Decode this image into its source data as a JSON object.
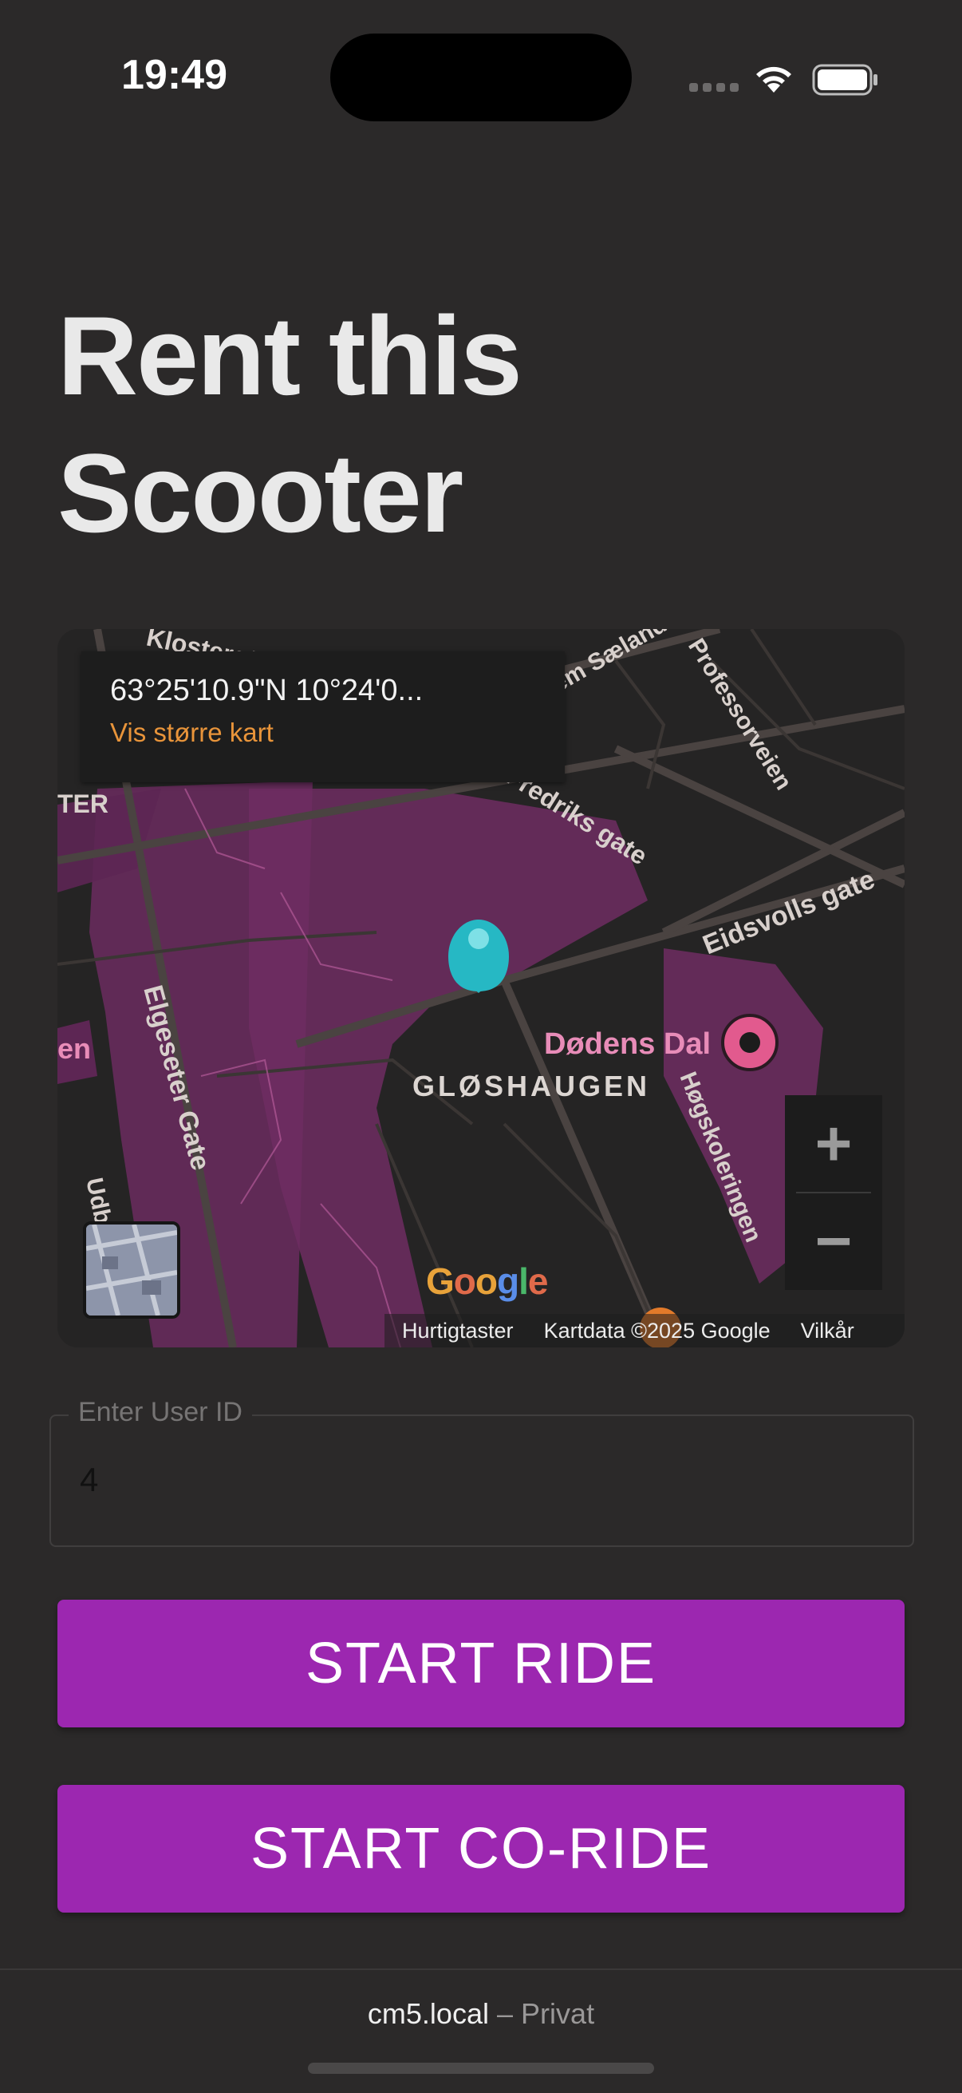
{
  "status_bar": {
    "time": "19:49"
  },
  "page": {
    "title_line1": "Rent this",
    "title_line2": "Scooter"
  },
  "map": {
    "coordinates": "63°25'10.9\"N 10°24'0...",
    "view_larger_link": "Vis større kart",
    "labels": {
      "klostergata": "Klostergt.",
      "fr_gate": "Fredriks gate",
      "s_gate": "Sem Sælands gate",
      "professorveien": "Professorveien",
      "eidsvolls_gate": "Eidsvolls gate",
      "elgeseter_gate": "Elgeseter Gate",
      "gloshaugen": "GLØSHAUGEN",
      "dodens_dal": "Dødens Dal",
      "hogskoleringen": "Høgskoleringen",
      "ter": "TER",
      "en": "en",
      "udb": "Udb"
    },
    "zoom_in": "+",
    "zoom_out": "−",
    "google_logo": "Google",
    "shortcuts": "Hurtigtaster",
    "map_data": "Kartdata ©2025 Google",
    "terms": "Vilkår",
    "marker_color": "#26b8c4",
    "poi_color": "#e25a8e"
  },
  "form": {
    "user_id_label": "Enter User ID",
    "user_id_value": "4"
  },
  "buttons": {
    "start_ride": "START RIDE",
    "start_coride": "START CO-RIDE"
  },
  "browser": {
    "host": "cm5.local",
    "separator": "–",
    "mode": "Privat"
  },
  "colors": {
    "background": "#2b2929",
    "button": "#9c27b0",
    "link": "#e8943a"
  }
}
